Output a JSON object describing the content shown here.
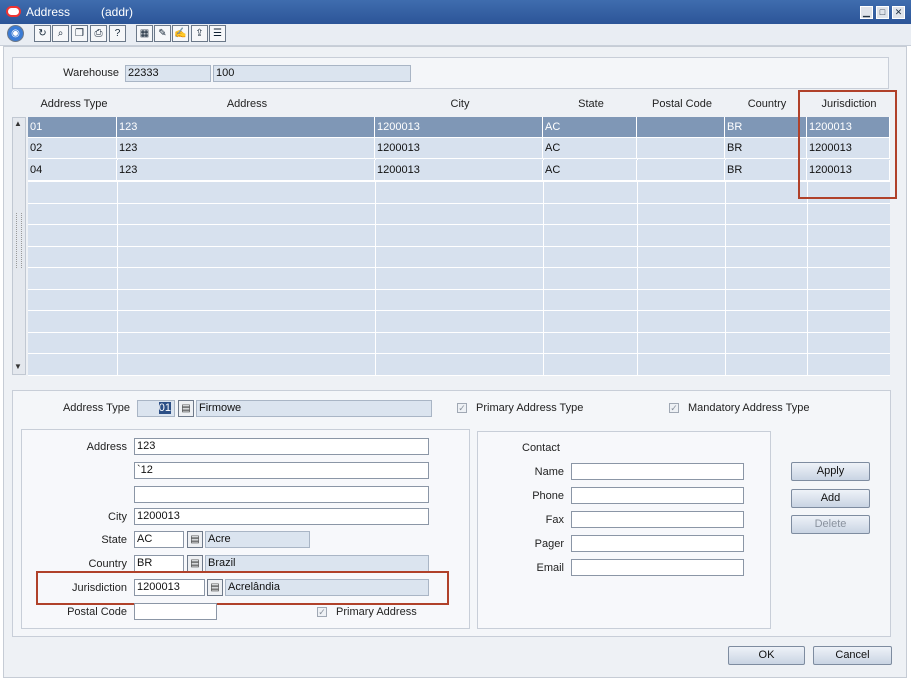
{
  "window": {
    "title": "Address",
    "subtitle": "(addr)",
    "minimize_icon": "minimize-icon",
    "maximize_icon": "maximize-icon",
    "close_icon": "close-icon"
  },
  "toolbar": {
    "icons": [
      "globe-icon",
      "refresh-icon",
      "find-icon",
      "copy-icon",
      "print-icon",
      "help-icon",
      "grid-icon",
      "edit-icon",
      "note-icon",
      "export-icon",
      "list-icon"
    ]
  },
  "header": {
    "warehouse_label": "Warehouse",
    "warehouse_id": "22333",
    "warehouse_name": "100"
  },
  "grid": {
    "columns": [
      "Address Type",
      "Address",
      "City",
      "State",
      "Postal Code",
      "Country",
      "Jurisdiction"
    ],
    "rows": [
      {
        "type": "01",
        "address": "123",
        "city": "1200013",
        "state": "AC",
        "postal": "",
        "country": "BR",
        "jurisdiction": "1200013"
      },
      {
        "type": "02",
        "address": "123",
        "city": "1200013",
        "state": "AC",
        "postal": "",
        "country": "BR",
        "jurisdiction": "1200013"
      },
      {
        "type": "04",
        "address": "123",
        "city": "1200013",
        "state": "AC",
        "postal": "",
        "country": "BR",
        "jurisdiction": "1200013"
      }
    ]
  },
  "detail": {
    "address_type_label": "Address Type",
    "address_type_value": "01",
    "address_type_desc": "Firmowe",
    "primary_address_type_label": "Primary Address Type",
    "mandatory_address_type_label": "Mandatory Address Type",
    "address_label": "Address",
    "address_line1": "123",
    "address_line2": "`12",
    "address_line3": "",
    "city_label": "City",
    "city_value": "1200013",
    "state_label": "State",
    "state_value": "AC",
    "state_desc": "Acre",
    "country_label": "Country",
    "country_value": "BR",
    "country_desc": "Brazil",
    "jurisdiction_label": "Jurisdiction",
    "jurisdiction_value": "1200013",
    "jurisdiction_desc": "Acrelândia",
    "postal_code_label": "Postal Code",
    "postal_code_value": "",
    "primary_address_label": "Primary Address"
  },
  "contact": {
    "title": "Contact",
    "name_label": "Name",
    "phone_label": "Phone",
    "fax_label": "Fax",
    "pager_label": "Pager",
    "email_label": "Email",
    "name": "",
    "phone": "",
    "fax": "",
    "pager": "",
    "email": ""
  },
  "buttons": {
    "apply": "Apply",
    "add": "Add",
    "delete": "Delete",
    "ok": "OK",
    "cancel": "Cancel"
  },
  "colors": {
    "title_bar": "#2c5598",
    "selected_row": "#7f97b6",
    "highlight": "#b0412a"
  }
}
